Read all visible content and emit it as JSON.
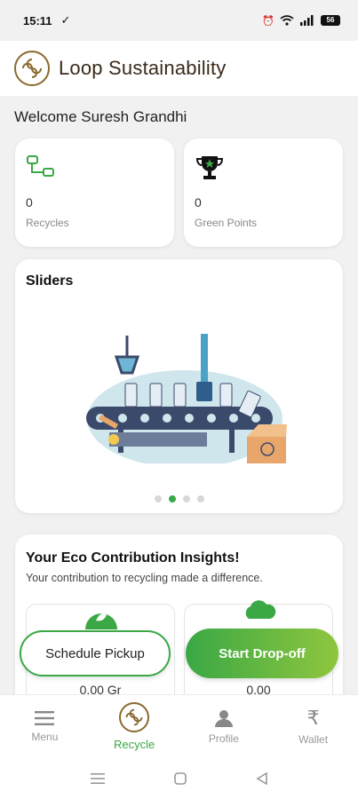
{
  "status_bar": {
    "time": "15:11",
    "battery": "56"
  },
  "header": {
    "app_title": "Loop Sustainability"
  },
  "welcome": {
    "text": "Welcome Suresh Grandhi"
  },
  "stats": [
    {
      "value": "0",
      "label": "Recycles",
      "icon": "recycle-flow-icon"
    },
    {
      "value": "0",
      "label": "Green Points",
      "icon": "trophy-icon"
    }
  ],
  "sliders": {
    "title": "Sliders",
    "dot_count": 4,
    "active_index": 1,
    "image": "recycling-conveyor-illustration"
  },
  "insights": {
    "title": "Your Eco Contribution Insights!",
    "subtitle": "Your contribution to recycling made a difference.",
    "cards": [
      {
        "value": "0.00 Gr",
        "icon": "eco-leaf-icon"
      },
      {
        "value": "0.00",
        "icon": "cloud-icon"
      }
    ]
  },
  "actions": {
    "schedule_label": "Schedule Pickup",
    "dropoff_label": "Start Drop-off"
  },
  "bottom_nav": [
    {
      "label": "Menu",
      "icon": "menu-icon",
      "active": false
    },
    {
      "label": "Recycle",
      "icon": "loop-logo-icon",
      "active": true
    },
    {
      "label": "Profile",
      "icon": "profile-icon",
      "active": false
    },
    {
      "label": "Wallet",
      "icon": "rupee-icon",
      "active": false
    }
  ],
  "colors": {
    "accent": "#3aa845",
    "brand_brown": "#8a6a2e",
    "background": "#f1f1f1"
  }
}
